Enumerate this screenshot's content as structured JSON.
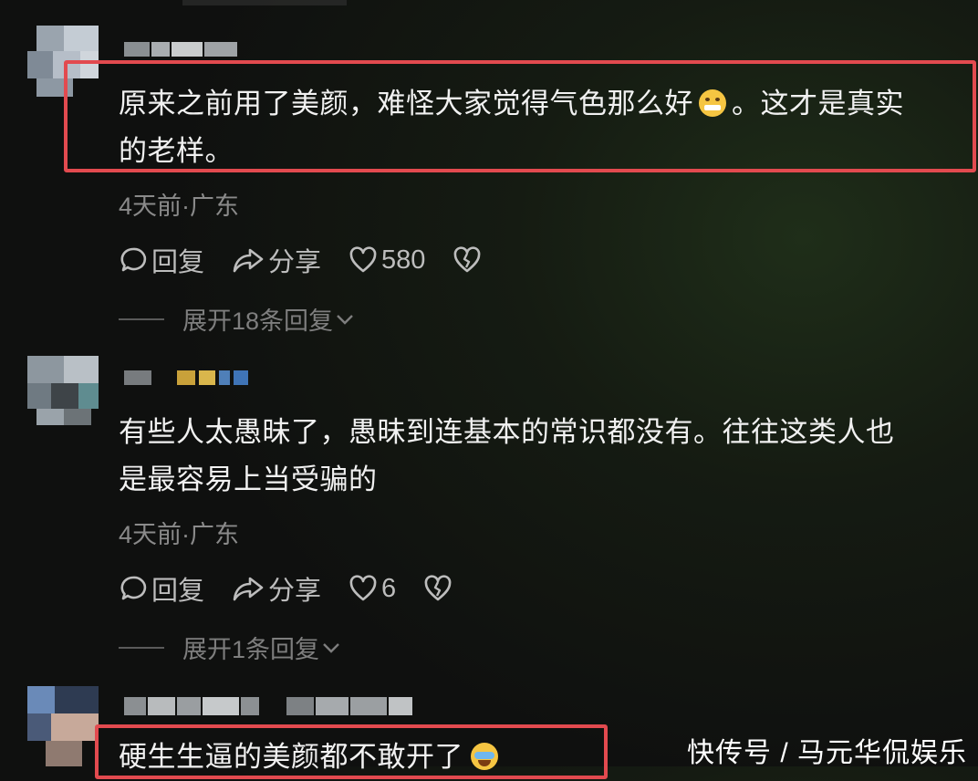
{
  "comments": [
    {
      "text_line1": "原来之前用了美颜，难怪大家觉得气色那么好",
      "text_tail": "。这才是真实",
      "text_line2": "的老样。",
      "emoji": "grimace-sweat-emoji",
      "meta": "4天前·广东",
      "actions": {
        "reply": "回复",
        "share": "分享",
        "likes": "580"
      },
      "expand": "展开18条回复"
    },
    {
      "text_line1": "有些人太愚昧了，愚昧到连基本的常识都没有。往往这类人也",
      "text_line2": "是最容易上当受骗的",
      "meta": "4天前·广东",
      "actions": {
        "reply": "回复",
        "share": "分享",
        "likes": "6"
      },
      "expand": "展开1条回复"
    },
    {
      "text_line1": "硬生生逼的美颜都不敢开了",
      "emoji": "crying-laughing-emoji"
    }
  ],
  "watermark": "快传号 / 马元华侃娱乐",
  "colors": {
    "highlight": "#e24a4f",
    "muted": "#8a8a8a"
  }
}
